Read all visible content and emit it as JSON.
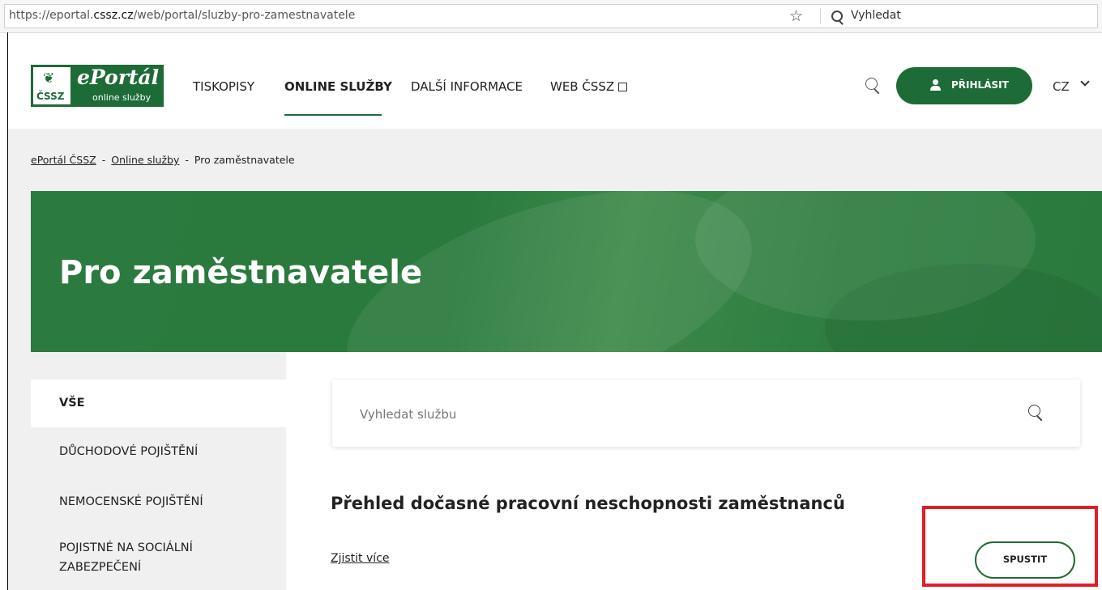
{
  "browser": {
    "url_prefix": "https://eportal.",
    "url_domain": "cssz.cz",
    "url_path": "/web/portal/sluzby-pro-zamestnavatele",
    "search_placeholder": "Vyhledat"
  },
  "header": {
    "logo": {
      "name": "ePortál",
      "subtitle": "online služby",
      "org": "ČSSZ"
    },
    "nav": [
      {
        "label": "TISKOPISY"
      },
      {
        "label": "ONLINE SLUŽBY"
      },
      {
        "label": "DALŠÍ INFORMACE"
      },
      {
        "label": "WEB ČSSZ"
      }
    ],
    "login_label": "PŘIHLÁSIT",
    "language": "CZ"
  },
  "breadcrumb": {
    "items": [
      "ePortál ČSSZ",
      "Online služby",
      "Pro zaměstnavatele"
    ],
    "separator": "-"
  },
  "hero": {
    "title": "Pro zaměstnavatele"
  },
  "sidebar": {
    "items": [
      {
        "label": "VŠE"
      },
      {
        "label": "DŮCHODOVÉ POJIŠTĚNÍ"
      },
      {
        "label": "NEMOCENSKÉ POJIŠTĚNÍ"
      },
      {
        "label": "POJISTNÉ NA SOCIÁLNÍ ZABEZPEČENÍ"
      }
    ]
  },
  "main": {
    "search_placeholder": "Vyhledat službu",
    "service": {
      "title": "Přehled dočasné pracovní neschopnosti zaměstnanců",
      "more_label": "Zjistit více",
      "run_label": "SPUSTIT"
    }
  },
  "colors": {
    "brand_green": "#1d6b36",
    "highlight_red": "#e01e26"
  }
}
